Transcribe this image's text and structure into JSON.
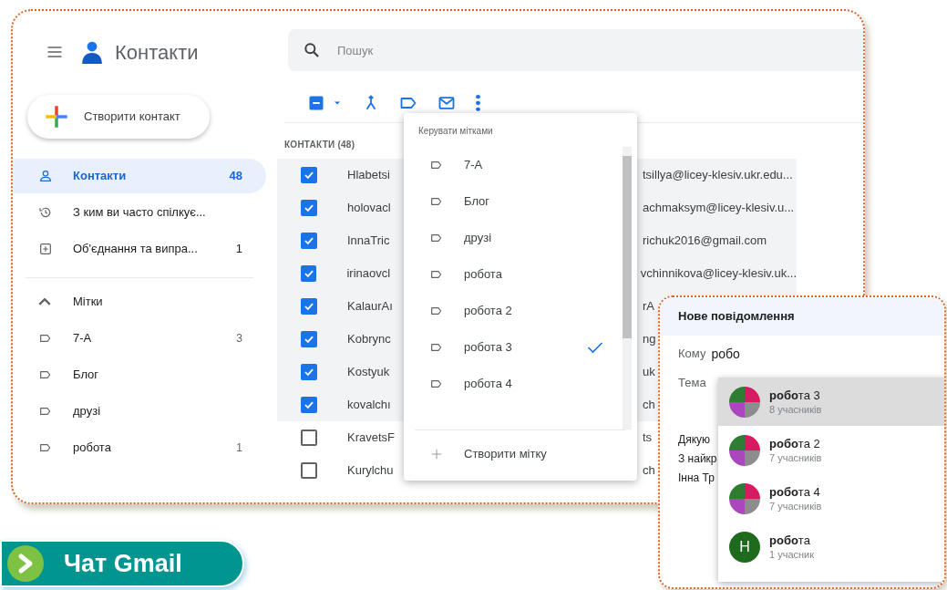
{
  "app": {
    "title": "Контакти",
    "create_button": "Створити контакт"
  },
  "sidebar": {
    "items": [
      {
        "label": "Контакти",
        "count": "48",
        "selected": true
      },
      {
        "label": "З ким ви часто спілкує...",
        "selected": false
      },
      {
        "label": "Об'єднання та випра...",
        "count": "1",
        "selected": false
      }
    ],
    "labels_header": {
      "label": "Мітки",
      "expanded": true
    },
    "labels": [
      {
        "label": "7-А",
        "count": "3"
      },
      {
        "label": "Блог"
      },
      {
        "label": "друзі"
      },
      {
        "label": "робота",
        "count": "1"
      }
    ]
  },
  "search": {
    "placeholder": "Пошук"
  },
  "toolbar": {
    "select_all_partial": true
  },
  "list_header": "КОНТАКТИ (48)",
  "contacts": [
    {
      "name": "Hlabetsi",
      "email": "tsillya@licey-klesiv.ukr.edu...",
      "checked": true
    },
    {
      "name": "holovacl",
      "email": "achmaksym@licey-klesiv.u...",
      "checked": true
    },
    {
      "name": "InnaTric",
      "email": "richuk2016@gmail.com",
      "checked": true
    },
    {
      "name": "irinaovcl",
      "email": "vchinnikova@licey-klesiv.uk...",
      "checked": true
    },
    {
      "name": "KalaurAı",
      "email": "rA",
      "checked": true
    },
    {
      "name": "Kobrync",
      "email": "ng",
      "checked": true
    },
    {
      "name": "Kostyuk",
      "email": "uk",
      "checked": true
    },
    {
      "name": "kovalchı",
      "email": "ch",
      "checked": true
    },
    {
      "name": "KravetsF",
      "email": "ts",
      "checked": false
    },
    {
      "name": "Kurylchu",
      "email": "ch",
      "checked": false
    }
  ],
  "label_menu": {
    "title": "Керувати мітками",
    "items": [
      {
        "label": "7-А",
        "checked": false
      },
      {
        "label": "Блог",
        "checked": false
      },
      {
        "label": "друзі",
        "checked": false
      },
      {
        "label": "робота",
        "checked": false
      },
      {
        "label": "робота 2",
        "checked": false
      },
      {
        "label": "робота 3",
        "checked": true
      },
      {
        "label": "робота 4",
        "checked": false
      }
    ],
    "create": "Створити мітку"
  },
  "compose": {
    "title": "Нове повідомлення",
    "to_label": "Кому",
    "to_value": "робо",
    "subject_label": "Тема",
    "body": [
      "Дякую",
      "З найкр",
      "Інна Тр"
    ],
    "suggestions": [
      {
        "name": "**робо**та 3",
        "members": "8 учасників",
        "selected": true
      },
      {
        "name": "**робо**та 2",
        "members": "7 учасників",
        "selected": false
      },
      {
        "name": "**робо**та 4",
        "members": "7 учасників",
        "selected": false
      },
      {
        "name": "**робо**та",
        "members": "1 учасник",
        "letter": "H",
        "selected": false
      }
    ]
  },
  "badge": {
    "label": "Чат Gmail"
  }
}
